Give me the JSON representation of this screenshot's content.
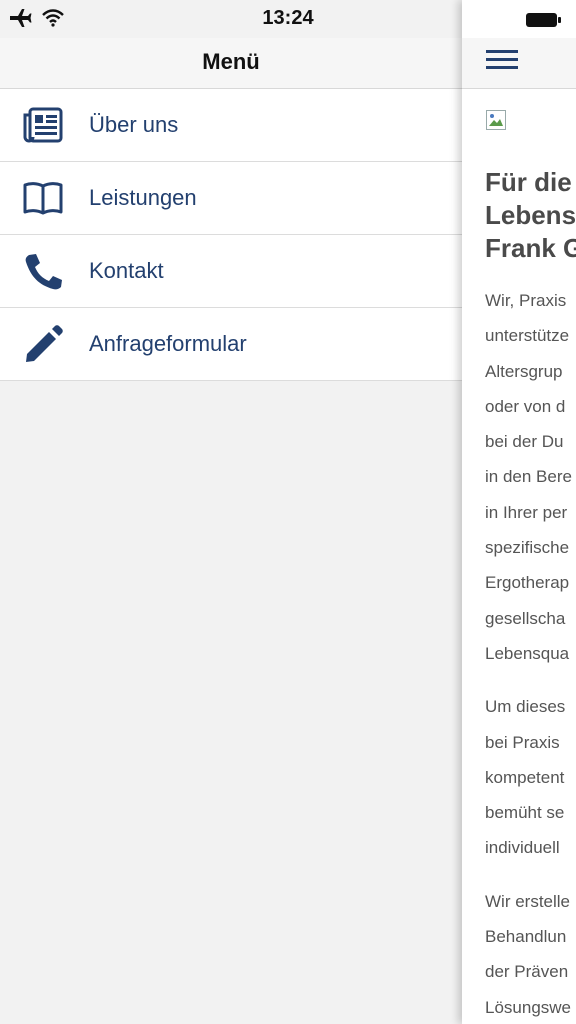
{
  "status_bar": {
    "time": "13:24",
    "icons": [
      "airplane-icon",
      "wifi-icon",
      "battery-icon"
    ]
  },
  "menu": {
    "title": "Menü",
    "items": [
      {
        "label": "Über uns",
        "icon": "newspaper-icon"
      },
      {
        "label": "Leistungen",
        "icon": "book-icon"
      },
      {
        "label": "Kontakt",
        "icon": "phone-icon"
      },
      {
        "label": "Anfrageformular",
        "icon": "pencil-icon"
      }
    ]
  },
  "content": {
    "heading_lines": [
      "Für die",
      "Lebens",
      "Frank G"
    ],
    "paragraph1": [
      "Wir, Praxis",
      "unterstütze",
      "Altersgrup",
      "oder von d",
      "bei der Du",
      "in den Bere",
      "in Ihrer per",
      "spezifische",
      "Ergotherap",
      "gesellscha",
      "Lebensqua"
    ],
    "paragraph2": [
      "Um dieses",
      "bei Praxis",
      "kompetent",
      "bemüht se",
      "individuell"
    ],
    "paragraph3": [
      "Wir erstelle",
      "Behandlun",
      "der Präven",
      "Lösungswe"
    ]
  },
  "colors": {
    "accent": "#23406f",
    "background": "#f2f2f2",
    "panel": "#ffffff"
  }
}
